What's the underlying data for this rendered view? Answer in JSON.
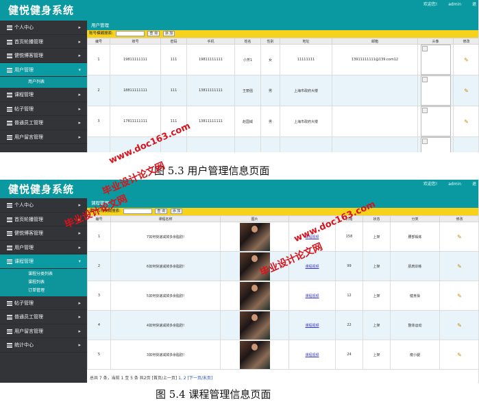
{
  "screen1": {
    "app_title": "健悦健身系统",
    "top_right": {
      "welcome": "欢迎您!",
      "user": "admin",
      "extra": "退"
    },
    "sidebar": [
      {
        "label": "个人中心",
        "active": false
      },
      {
        "label": "首页轮播管理",
        "active": false
      },
      {
        "label": "健悦博客管理",
        "active": false
      },
      {
        "label": "用户管理",
        "active": true
      },
      {
        "label": "课程管理",
        "active": false
      },
      {
        "label": "帖子管理",
        "active": false
      },
      {
        "label": "普通员工管理",
        "active": false
      },
      {
        "label": "用户留言管理",
        "active": false
      }
    ],
    "submenu": [
      "用户列表"
    ],
    "panel_title": "用户管理",
    "search": {
      "label": "账号模糊搜索:",
      "search_btn": "查 询",
      "add_btn": "添 加"
    },
    "columns": [
      "编号",
      "账号",
      "密码",
      "手机",
      "姓名",
      "性别",
      "地址",
      "邮箱",
      "头像",
      "修改"
    ],
    "rows": [
      {
        "id": "1",
        "account": "19811111111",
        "password": "111",
        "phone": "19811111111",
        "name": "小芳1",
        "gender": "女",
        "address": "11111111",
        "email": "13911111111@139.com12"
      },
      {
        "id": "2",
        "account": "18811111111",
        "password": "111",
        "phone": "13811111111",
        "name": "王丽强",
        "gender": "男",
        "address": "上海市政府大楼",
        "email": ""
      },
      {
        "id": "3",
        "account": "17811111111",
        "password": "111",
        "phone": "13811111111",
        "name": "赵国威",
        "gender": "男",
        "address": "上海市政府大楼",
        "email": ""
      },
      {
        "id": "",
        "account": "",
        "password": "",
        "phone": "",
        "name": "",
        "gender": "",
        "address": "",
        "email": ""
      }
    ],
    "caption": "图 5.3 用户管理信息页面"
  },
  "screen2": {
    "app_title": "健悦健身系统",
    "top_right": {
      "welcome": "欢迎您!",
      "user": "admin",
      "extra": "退"
    },
    "sidebar_top": [
      {
        "label": "个人中心",
        "active": false
      },
      {
        "label": "首页轮播管理",
        "active": false
      },
      {
        "label": "健悦博客管理",
        "active": false
      },
      {
        "label": "用户管理",
        "active": false
      },
      {
        "label": "课程管理",
        "active": true
      }
    ],
    "submenu": [
      "课程分类列表",
      "课程列表",
      "订单管理"
    ],
    "sidebar_bottom": [
      {
        "label": "帖子管理",
        "active": false
      },
      {
        "label": "普通员工管理",
        "active": false
      },
      {
        "label": "用户留言管理",
        "active": false
      },
      {
        "label": "统计中心",
        "active": false
      }
    ],
    "panel_title": "课程管理",
    "search": {
      "label": "课程名称模糊搜索:",
      "search_btn": "查 询",
      "add_btn": "添 加"
    },
    "columns": [
      "编号",
      "课程名称",
      "图片",
      "",
      "价格",
      "状态",
      "分类",
      "修改"
    ],
    "rows": [
      {
        "id": "1",
        "name": "7如何快速减掉多余脂肪!",
        "link": "课程视频",
        "price": "158",
        "status": "上架",
        "category": "腰部锻炼"
      },
      {
        "id": "2",
        "name": "6如何快速减掉多余脂肪!",
        "link": "课程视频",
        "price": "99",
        "status": "上架",
        "category": "肌肉训练"
      },
      {
        "id": "3",
        "name": "5如何快速减掉多余脂肪!",
        "link": "课程视频",
        "price": "12",
        "status": "上架",
        "category": "健身操"
      },
      {
        "id": "4",
        "name": "4如何快速减掉多余脂肪!",
        "link": "课程视频",
        "price": "22",
        "status": "上架",
        "category": "整体运动"
      },
      {
        "id": "5",
        "name": "3如何快速减掉多余脂肪!",
        "link": "课程视频",
        "price": "24",
        "status": "上架",
        "category": "瘦小腿"
      }
    ],
    "pager": {
      "summary": "总共 7 条，当前 1 至 5 条 共2页 [首页/上一页]",
      "pages": "1, 2",
      "next": "[下一页/末页]"
    },
    "caption": "图 5.4 课程管理信息页面"
  },
  "watermarks": [
    "毕业设计论文网",
    "www.doc163.com"
  ],
  "colors": {
    "teal": "#0a99a0",
    "sidebar": "#323438",
    "searchbar": "#f6d21c",
    "watermark": "#d9121b"
  }
}
